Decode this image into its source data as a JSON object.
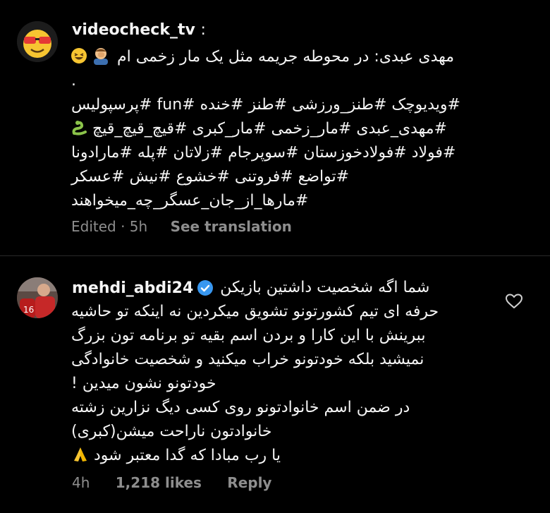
{
  "caption": {
    "username": "videocheck_tv",
    "colon": ":",
    "line1": "مهدی عبدی: در محوطه جریمه مثل یک مار زخمی ام",
    "dot": ".",
    "hashtags": [
      "#ویدیوچک #طنز_ورزشی #طنز #خنده #fun #پرسپولیس",
      "#مهدی_عبدی #مار_زخمی #مار_کبری #قیچ_قیچ_قیچ",
      "#فولاد #فولادخوزستان #سوپرجام #زلاتان #پله #مارادونا",
      "#تواضع #فروتنی #خشوع #نیش #عسکر",
      "#مارها_از_جان_عسگر_چه_میخواهند"
    ],
    "edited": "Edited · 5h",
    "see_translation": "See translation",
    "emojis": [
      "laughing-emoji",
      "man-facepalming-emoji",
      "snake-emoji"
    ]
  },
  "comment": {
    "username": "mehdi_abdi24",
    "lines": [
      "شما اگه شخصیت داشتین بازیکن",
      "حرفه ای تیم کشورتونو تشویق میکردین نه اینکه تو حاشیه",
      "ببرینش با این کارا و بردن اسم بقیه تو برنامه تون بزرگ",
      "نمیشید بلکه خودتونو خراب میکنید و شخصیت خانوادگی",
      "خودتونو نشون میدین !",
      "در ضمن اسم خانوادتونو روی کسی دیگ نزارین زشته",
      "خانوادتون ناراحت میشن(کبری)",
      "یا رب مبادا که گدا معتبر شود"
    ],
    "time": "4h",
    "likes": "1,218 likes",
    "reply": "Reply",
    "emojis": [
      "folded-hands-emoji"
    ]
  },
  "colors": {
    "background": "#000000",
    "text": "#f5f5f5",
    "muted": "#8e8e8e",
    "verified": "#3897f0"
  }
}
